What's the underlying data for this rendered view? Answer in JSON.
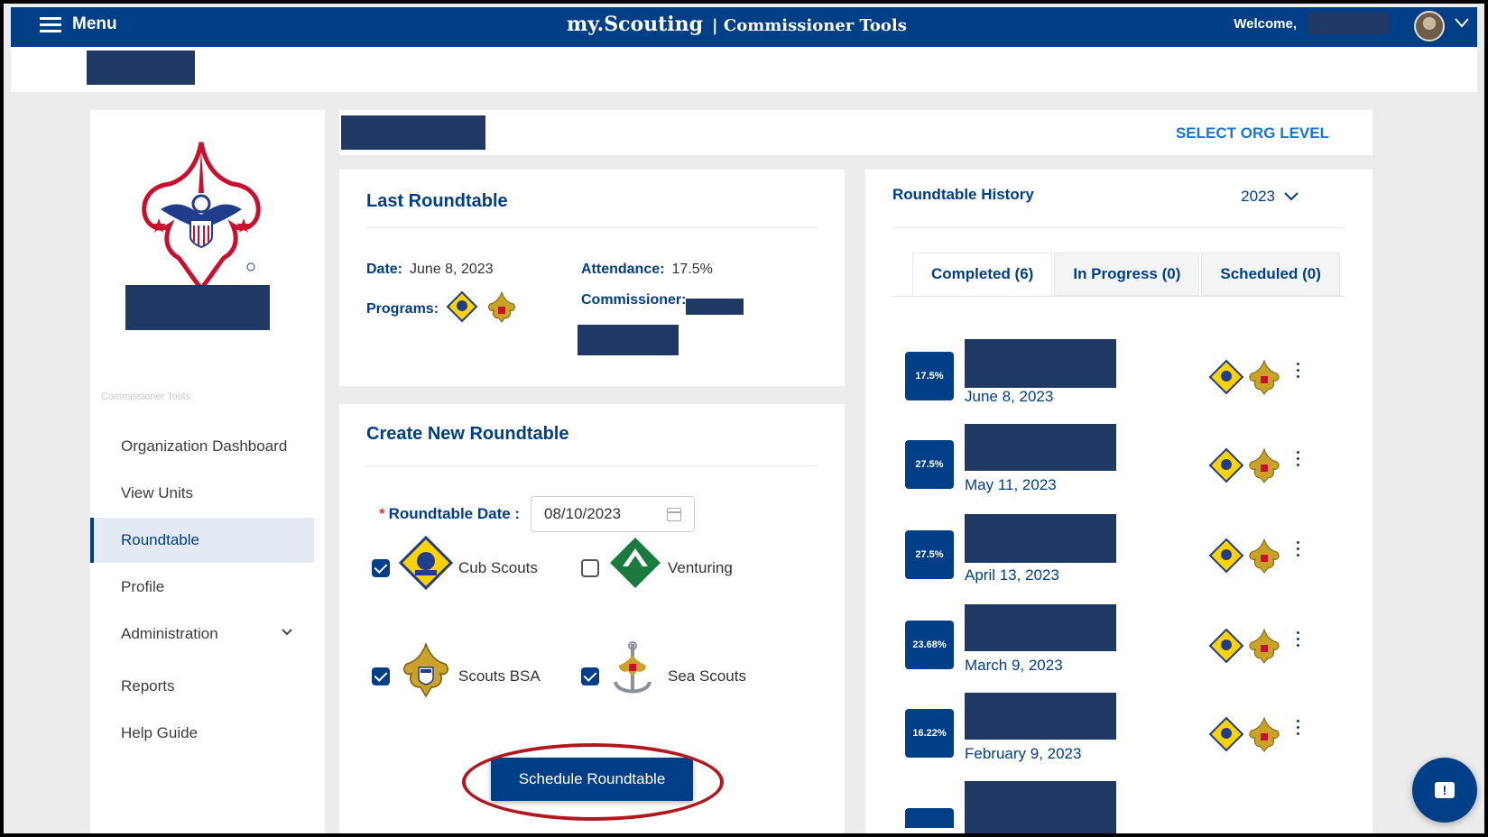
{
  "topbar": {
    "menu_label": "Menu",
    "brand": "my.Scouting",
    "brand_suffix": "| Commissioner Tools",
    "welcome": "Welcome,"
  },
  "header": {
    "select_org_level": "SELECT ORG LEVEL"
  },
  "sidebar": {
    "caption": "Commissioner Tools",
    "items": [
      {
        "label": "Organization Dashboard",
        "active": false
      },
      {
        "label": "View Units",
        "active": false
      },
      {
        "label": "Roundtable",
        "active": true
      },
      {
        "label": "Profile",
        "active": false
      },
      {
        "label": "Administration",
        "active": false,
        "expandable": true
      },
      {
        "label": "Reports",
        "active": false
      },
      {
        "label": "Help Guide",
        "active": false
      }
    ]
  },
  "last_roundtable": {
    "title": "Last Roundtable",
    "date_label": "Date:",
    "date_value": "June 8, 2023",
    "attendance_label": "Attendance:",
    "attendance_value": "17.5%",
    "programs_label": "Programs:",
    "commissioner_label": "Commissioner:"
  },
  "create_roundtable": {
    "title": "Create New Roundtable",
    "date_label": "Roundtable Date",
    "date_value": "08/10/2023",
    "programs": [
      {
        "label": "Cub Scouts",
        "checked": true,
        "icon": "cub-scouts-icon"
      },
      {
        "label": "Venturing",
        "checked": false,
        "icon": "venturing-icon"
      },
      {
        "label": "Scouts BSA",
        "checked": true,
        "icon": "scouts-bsa-icon"
      },
      {
        "label": "Sea Scouts",
        "checked": true,
        "icon": "sea-scouts-icon"
      }
    ],
    "schedule_button": "Schedule Roundtable"
  },
  "history": {
    "title": "Roundtable History",
    "year": "2023",
    "tabs": [
      {
        "label": "Completed (6)",
        "active": true
      },
      {
        "label": "In Progress (0)",
        "active": false
      },
      {
        "label": "Scheduled (0)",
        "active": false
      }
    ],
    "rows": [
      {
        "percent": "17.5%",
        "date": "June 8, 2023"
      },
      {
        "percent": "27.5%",
        "date": "May 11, 2023"
      },
      {
        "percent": "27.5%",
        "date": "April 13, 2023"
      },
      {
        "percent": "23.68%",
        "date": "March 9, 2023"
      },
      {
        "percent": "16.22%",
        "date": "February 9, 2023"
      }
    ]
  },
  "colors": {
    "primary": "#003f87",
    "link": "#1a75d2",
    "redaction": "#1f3864",
    "highlight": "#b1181d"
  }
}
